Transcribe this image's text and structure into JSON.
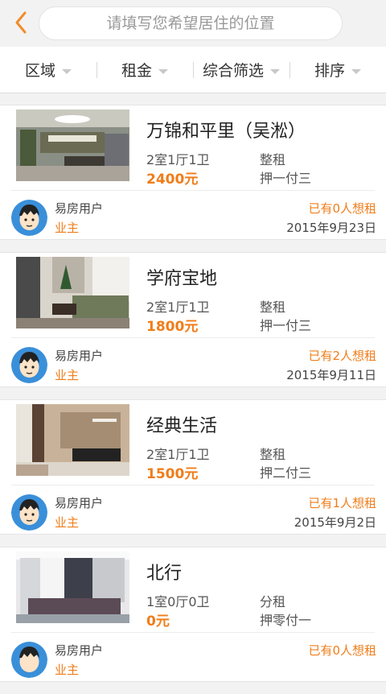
{
  "header": {
    "search_placeholder": "请填写您希望居住的位置"
  },
  "filters": [
    "区域",
    "租金",
    "综合筛选",
    "排序"
  ],
  "colors": {
    "accent": "#f07d1a",
    "back_arrow": "#f08c2a"
  },
  "listings": [
    {
      "title": "万锦和平里（吴淞）",
      "layout": "2室1厅1卫",
      "price": "2400元",
      "rent_type": "整租",
      "payment": "押一付三",
      "user": "易房用户",
      "role": "业主",
      "wanted": "已有0人想租",
      "date": "2015年9月23日"
    },
    {
      "title": "学府宝地",
      "layout": "2室1厅1卫",
      "price": "1800元",
      "rent_type": "整租",
      "payment": "押一付三",
      "user": "易房用户",
      "role": "业主",
      "wanted": "已有2人想租",
      "date": "2015年9月11日"
    },
    {
      "title": "经典生活",
      "layout": "2室1厅1卫",
      "price": "1500元",
      "rent_type": "整租",
      "payment": "押二付三",
      "user": "易房用户",
      "role": "业主",
      "wanted": "已有1人想租",
      "date": "2015年9月2日"
    },
    {
      "title": "北行",
      "layout": "1室0厅0卫",
      "price": "0元",
      "rent_type": "分租",
      "payment": "押零付一",
      "user": "易房用户",
      "role": "业主",
      "wanted": "已有0人想租",
      "date": ""
    }
  ]
}
